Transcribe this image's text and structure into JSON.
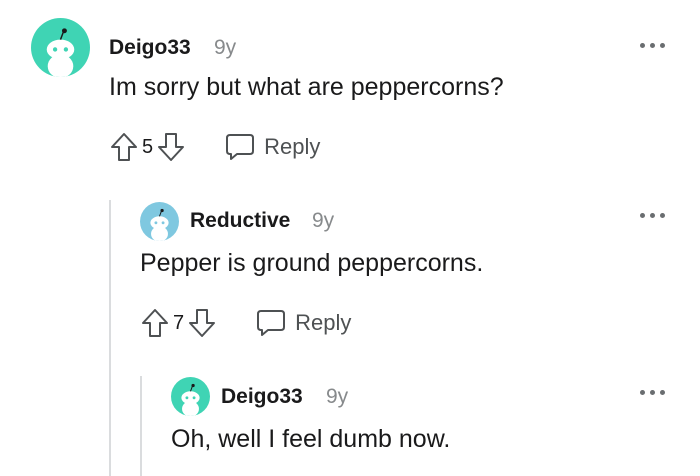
{
  "comments": [
    {
      "username": "Deigo33",
      "age": "9y",
      "body": "Im sorry but what are peppercorns?",
      "score": "5",
      "reply_label": "Reply",
      "avatar_color": "#3fd4b4"
    },
    {
      "username": "Reductive",
      "age": "9y",
      "body": "Pepper is ground peppercorns.",
      "score": "7",
      "reply_label": "Reply",
      "avatar_color": "#7fc8e0"
    },
    {
      "username": "Deigo33",
      "age": "9y",
      "body": "Oh, well I feel dumb now.",
      "avatar_color": "#3fd4b4"
    }
  ],
  "icons": {
    "upvote": "arrow-up-outline",
    "downvote": "arrow-down-outline",
    "reply": "speech-bubble-outline",
    "more": "horizontal-ellipsis"
  }
}
